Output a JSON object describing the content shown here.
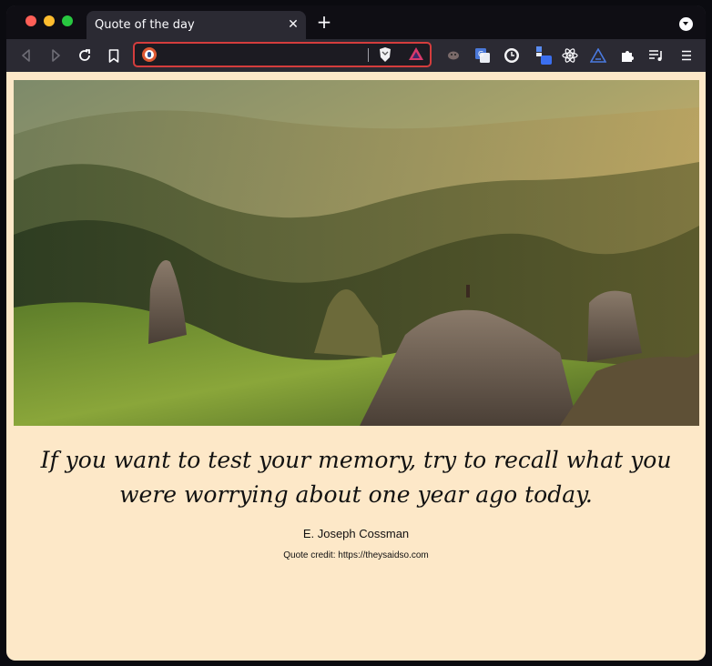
{
  "tab": {
    "title": "Quote of the day",
    "close_label": "✕",
    "new_tab_label": "+"
  },
  "toolbar": {
    "url_value": "",
    "url_placeholder": ""
  },
  "icons": {
    "back": "back-arrow-icon",
    "forward": "forward-arrow-icon",
    "reload": "reload-icon",
    "bookmark": "bookmark-icon",
    "site": "duckduckgo-icon",
    "brave": "brave-shield-icon",
    "rewards": "brave-rewards-icon",
    "extensions": [
      "pocket-icon",
      "translate-icon",
      "clock-extension-icon",
      "screenshot-extension-icon",
      "react-devtools-icon",
      "vpn-triangle-icon",
      "puzzle-extensions-icon",
      "reading-list-icon",
      "menu-icon"
    ]
  },
  "colors": {
    "page_background": "#fde8c8",
    "urlbar_border": "#d43d3d",
    "toolbar": "#2b2a33"
  },
  "quote": {
    "text": "If you want to test your memory, try to recall what you were worrying about one year ago today.",
    "author": "E. Joseph Cossman",
    "credit": "Quote credit: https://theysaidso.com"
  }
}
